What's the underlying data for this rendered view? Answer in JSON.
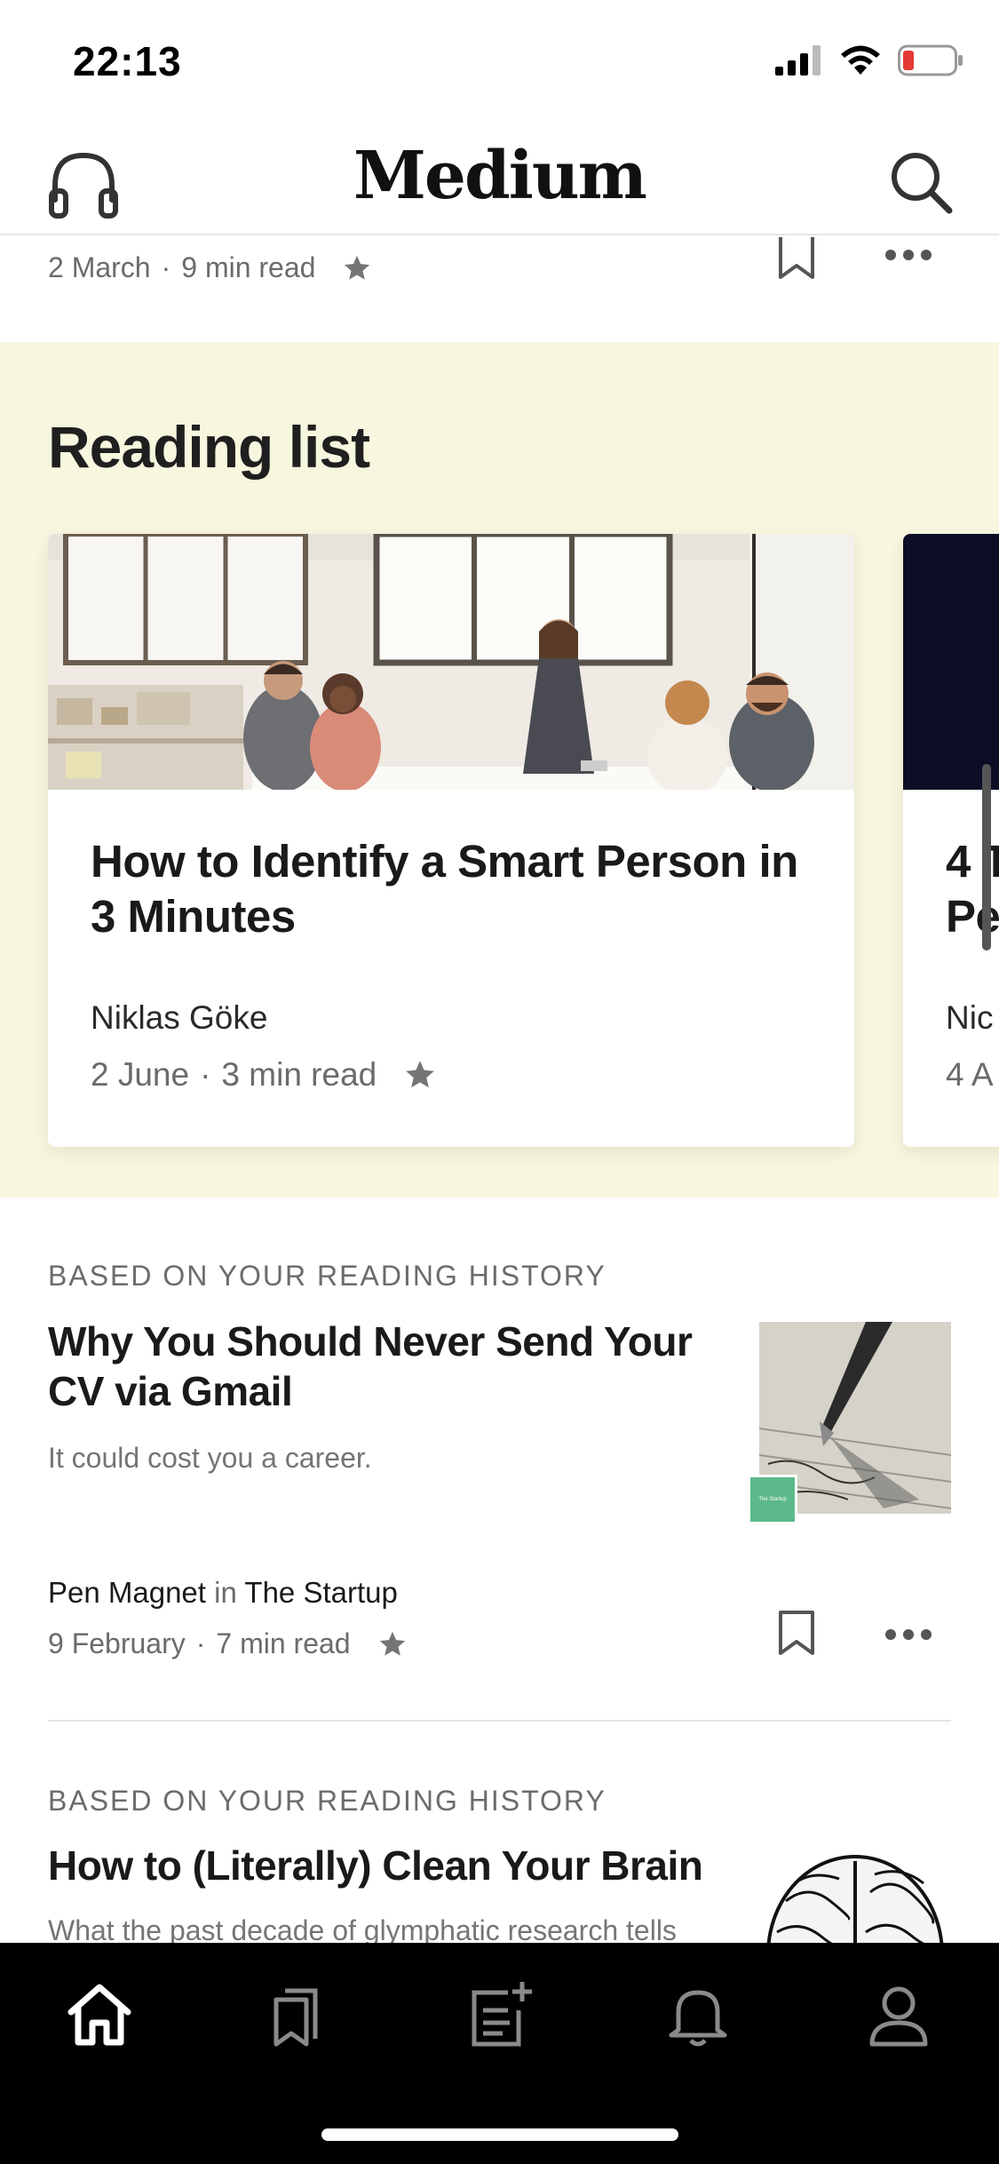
{
  "status_bar": {
    "time": "22:13"
  },
  "header": {
    "logo": "Medium",
    "left_icon": "headphones-icon",
    "right_icon": "search-icon"
  },
  "prev_article": {
    "date": "2 March",
    "read_time": "9 min read",
    "separator": "·"
  },
  "reading_list": {
    "title": "Reading list",
    "cards": [
      {
        "title": "How to Identify a Smart Person in 3 Minutes",
        "author": "Niklas Göke",
        "date": "2 June",
        "read_time": "3 min read"
      },
      {
        "title": "4 T Pe",
        "author": "Nic",
        "date": "4 A"
      }
    ]
  },
  "feed": [
    {
      "kicker": "BASED ON YOUR READING HISTORY",
      "title": "Why You Should Never Send Your CV via Gmail",
      "subtitle": "It could cost you a career.",
      "author": "Pen Magnet",
      "in": "in",
      "publication": "The Startup",
      "publication_badge": "The Startup",
      "date": "9 February",
      "read_time": "7 min read"
    },
    {
      "kicker": "BASED ON YOUR READING HISTORY",
      "title": "How to (Literally) Clean Your Brain",
      "subtitle": "What the past decade of glymphatic research tells"
    }
  ],
  "bottom_nav": {
    "items": [
      "home-icon",
      "bookmarks-icon",
      "new-story-icon",
      "notifications-icon",
      "profile-icon"
    ],
    "active": "home-icon"
  },
  "colors": {
    "reading_list_bg": "#f7f6de",
    "nav_bg": "#000000",
    "meta_text": "#6b6b6b",
    "badge_green": "#5db88a",
    "battery_low": "#e53935"
  }
}
